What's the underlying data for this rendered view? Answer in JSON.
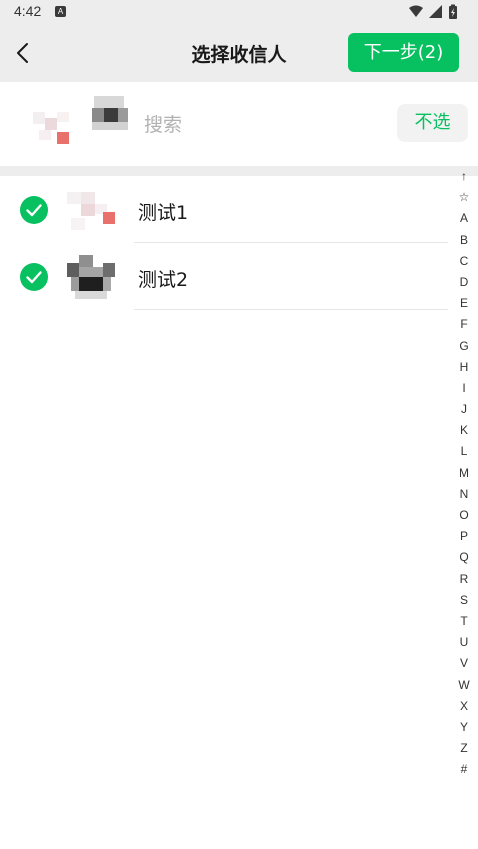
{
  "status_bar": {
    "time": "4:42",
    "indicator_letter": "A",
    "icons": [
      "wifi-icon",
      "signal-icon",
      "battery-icon"
    ]
  },
  "nav": {
    "back_icon": "chevron-left-icon",
    "title": "选择收信人",
    "next_label": "下一步(2)"
  },
  "search": {
    "placeholder": "搜索",
    "value": "",
    "deselect_label": "不选",
    "selected_avatars": [
      "avatar-blurred-1",
      "avatar-blurred-2"
    ]
  },
  "contacts": [
    {
      "name": "测试1",
      "checked": true
    },
    {
      "name": "测试2",
      "checked": true
    }
  ],
  "alpha_index": [
    "↑",
    "☆",
    "A",
    "B",
    "C",
    "D",
    "E",
    "F",
    "G",
    "H",
    "I",
    "J",
    "K",
    "L",
    "M",
    "N",
    "O",
    "P",
    "Q",
    "R",
    "S",
    "T",
    "U",
    "V",
    "W",
    "X",
    "Y",
    "Z",
    "#"
  ],
  "colors": {
    "accent": "#07c160",
    "header_bg": "#ededed",
    "text": "#191919",
    "placeholder": "#b2b2b2"
  }
}
